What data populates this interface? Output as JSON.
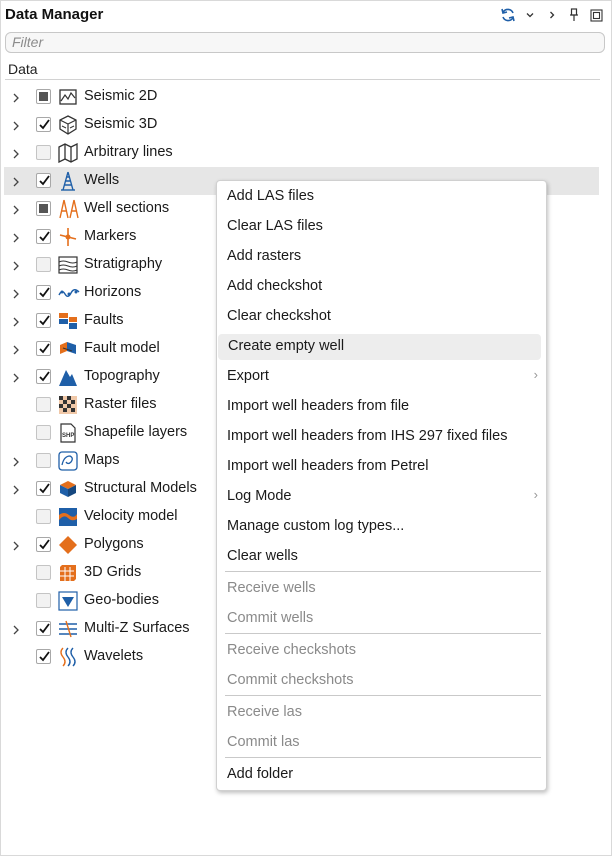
{
  "window": {
    "title": "Data Manager",
    "filter_placeholder": "Filter",
    "column_header": "Data"
  },
  "toolbar": {
    "refresh_icon": "refresh-icon",
    "collapse_icon": "chevron-down-icon",
    "more_icon": "chevron-right-icon",
    "pin_icon": "pin-icon",
    "maximize_icon": "maximize-icon"
  },
  "tree": [
    {
      "label": "Seismic 2D",
      "expandable": true,
      "check": "partial",
      "icon": "seismic-2d-icon"
    },
    {
      "label": "Seismic 3D",
      "expandable": true,
      "check": "checked",
      "icon": "seismic-3d-icon"
    },
    {
      "label": "Arbitrary lines",
      "expandable": true,
      "check": "empty",
      "icon": "arbitrary-lines-icon"
    },
    {
      "label": "Wells",
      "expandable": true,
      "check": "checked",
      "icon": "well-icon",
      "selected": true
    },
    {
      "label": "Well sections",
      "expandable": true,
      "check": "partial",
      "icon": "well-sections-icon"
    },
    {
      "label": "Markers",
      "expandable": true,
      "check": "checked",
      "icon": "markers-icon"
    },
    {
      "label": "Stratigraphy",
      "expandable": true,
      "check": "empty",
      "icon": "stratigraphy-icon"
    },
    {
      "label": "Horizons",
      "expandable": true,
      "check": "checked",
      "icon": "horizons-icon"
    },
    {
      "label": "Faults",
      "expandable": true,
      "check": "checked",
      "icon": "faults-icon"
    },
    {
      "label": "Fault model",
      "expandable": true,
      "check": "checked",
      "icon": "fault-model-icon"
    },
    {
      "label": "Topography",
      "expandable": true,
      "check": "checked",
      "icon": "topography-icon"
    },
    {
      "label": "Raster files",
      "expandable": false,
      "check": "empty",
      "icon": "raster-files-icon"
    },
    {
      "label": "Shapefile layers",
      "expandable": false,
      "check": "empty",
      "icon": "shapefile-icon"
    },
    {
      "label": "Maps",
      "expandable": true,
      "check": "empty",
      "icon": "maps-icon"
    },
    {
      "label": "Structural Models",
      "expandable": true,
      "check": "checked",
      "icon": "structural-models-icon"
    },
    {
      "label": "Velocity model",
      "expandable": false,
      "check": "empty",
      "icon": "velocity-model-icon"
    },
    {
      "label": "Polygons",
      "expandable": true,
      "check": "checked",
      "icon": "polygons-icon"
    },
    {
      "label": "3D Grids",
      "expandable": false,
      "check": "empty",
      "icon": "3d-grids-icon"
    },
    {
      "label": "Geo-bodies",
      "expandable": false,
      "check": "empty",
      "icon": "geo-bodies-icon"
    },
    {
      "label": "Multi-Z Surfaces",
      "expandable": true,
      "check": "checked",
      "icon": "multi-z-surfaces-icon"
    },
    {
      "label": "Wavelets",
      "expandable": false,
      "check": "checked",
      "icon": "wavelets-icon"
    }
  ],
  "context_menu": {
    "items": [
      {
        "label": "Add LAS files"
      },
      {
        "label": "Clear LAS files"
      },
      {
        "label": "Add rasters"
      },
      {
        "label": "Add checkshot"
      },
      {
        "label": "Clear checkshot"
      },
      {
        "label": "Create empty well",
        "hovered": true
      },
      {
        "label": "Export",
        "submenu": true
      },
      {
        "label": "Import well headers from file"
      },
      {
        "label": "Import well headers from IHS 297 fixed files"
      },
      {
        "label": "Import well headers from Petrel"
      },
      {
        "label": "Log Mode",
        "submenu": true
      },
      {
        "label": "Manage custom log types..."
      },
      {
        "label": "Clear wells"
      },
      {
        "label": "Receive wells",
        "disabled": true
      },
      {
        "label": "Commit wells",
        "disabled": true
      },
      {
        "label": "Receive checkshots",
        "disabled": true
      },
      {
        "label": "Commit checkshots",
        "disabled": true
      },
      {
        "label": "Receive las",
        "disabled": true
      },
      {
        "label": "Commit las",
        "disabled": true
      },
      {
        "label": "Add folder"
      }
    ]
  },
  "colors": {
    "accent_blue": "#1f5fa8",
    "orange": "#e46f1c",
    "selection": "#e6e6e6"
  }
}
